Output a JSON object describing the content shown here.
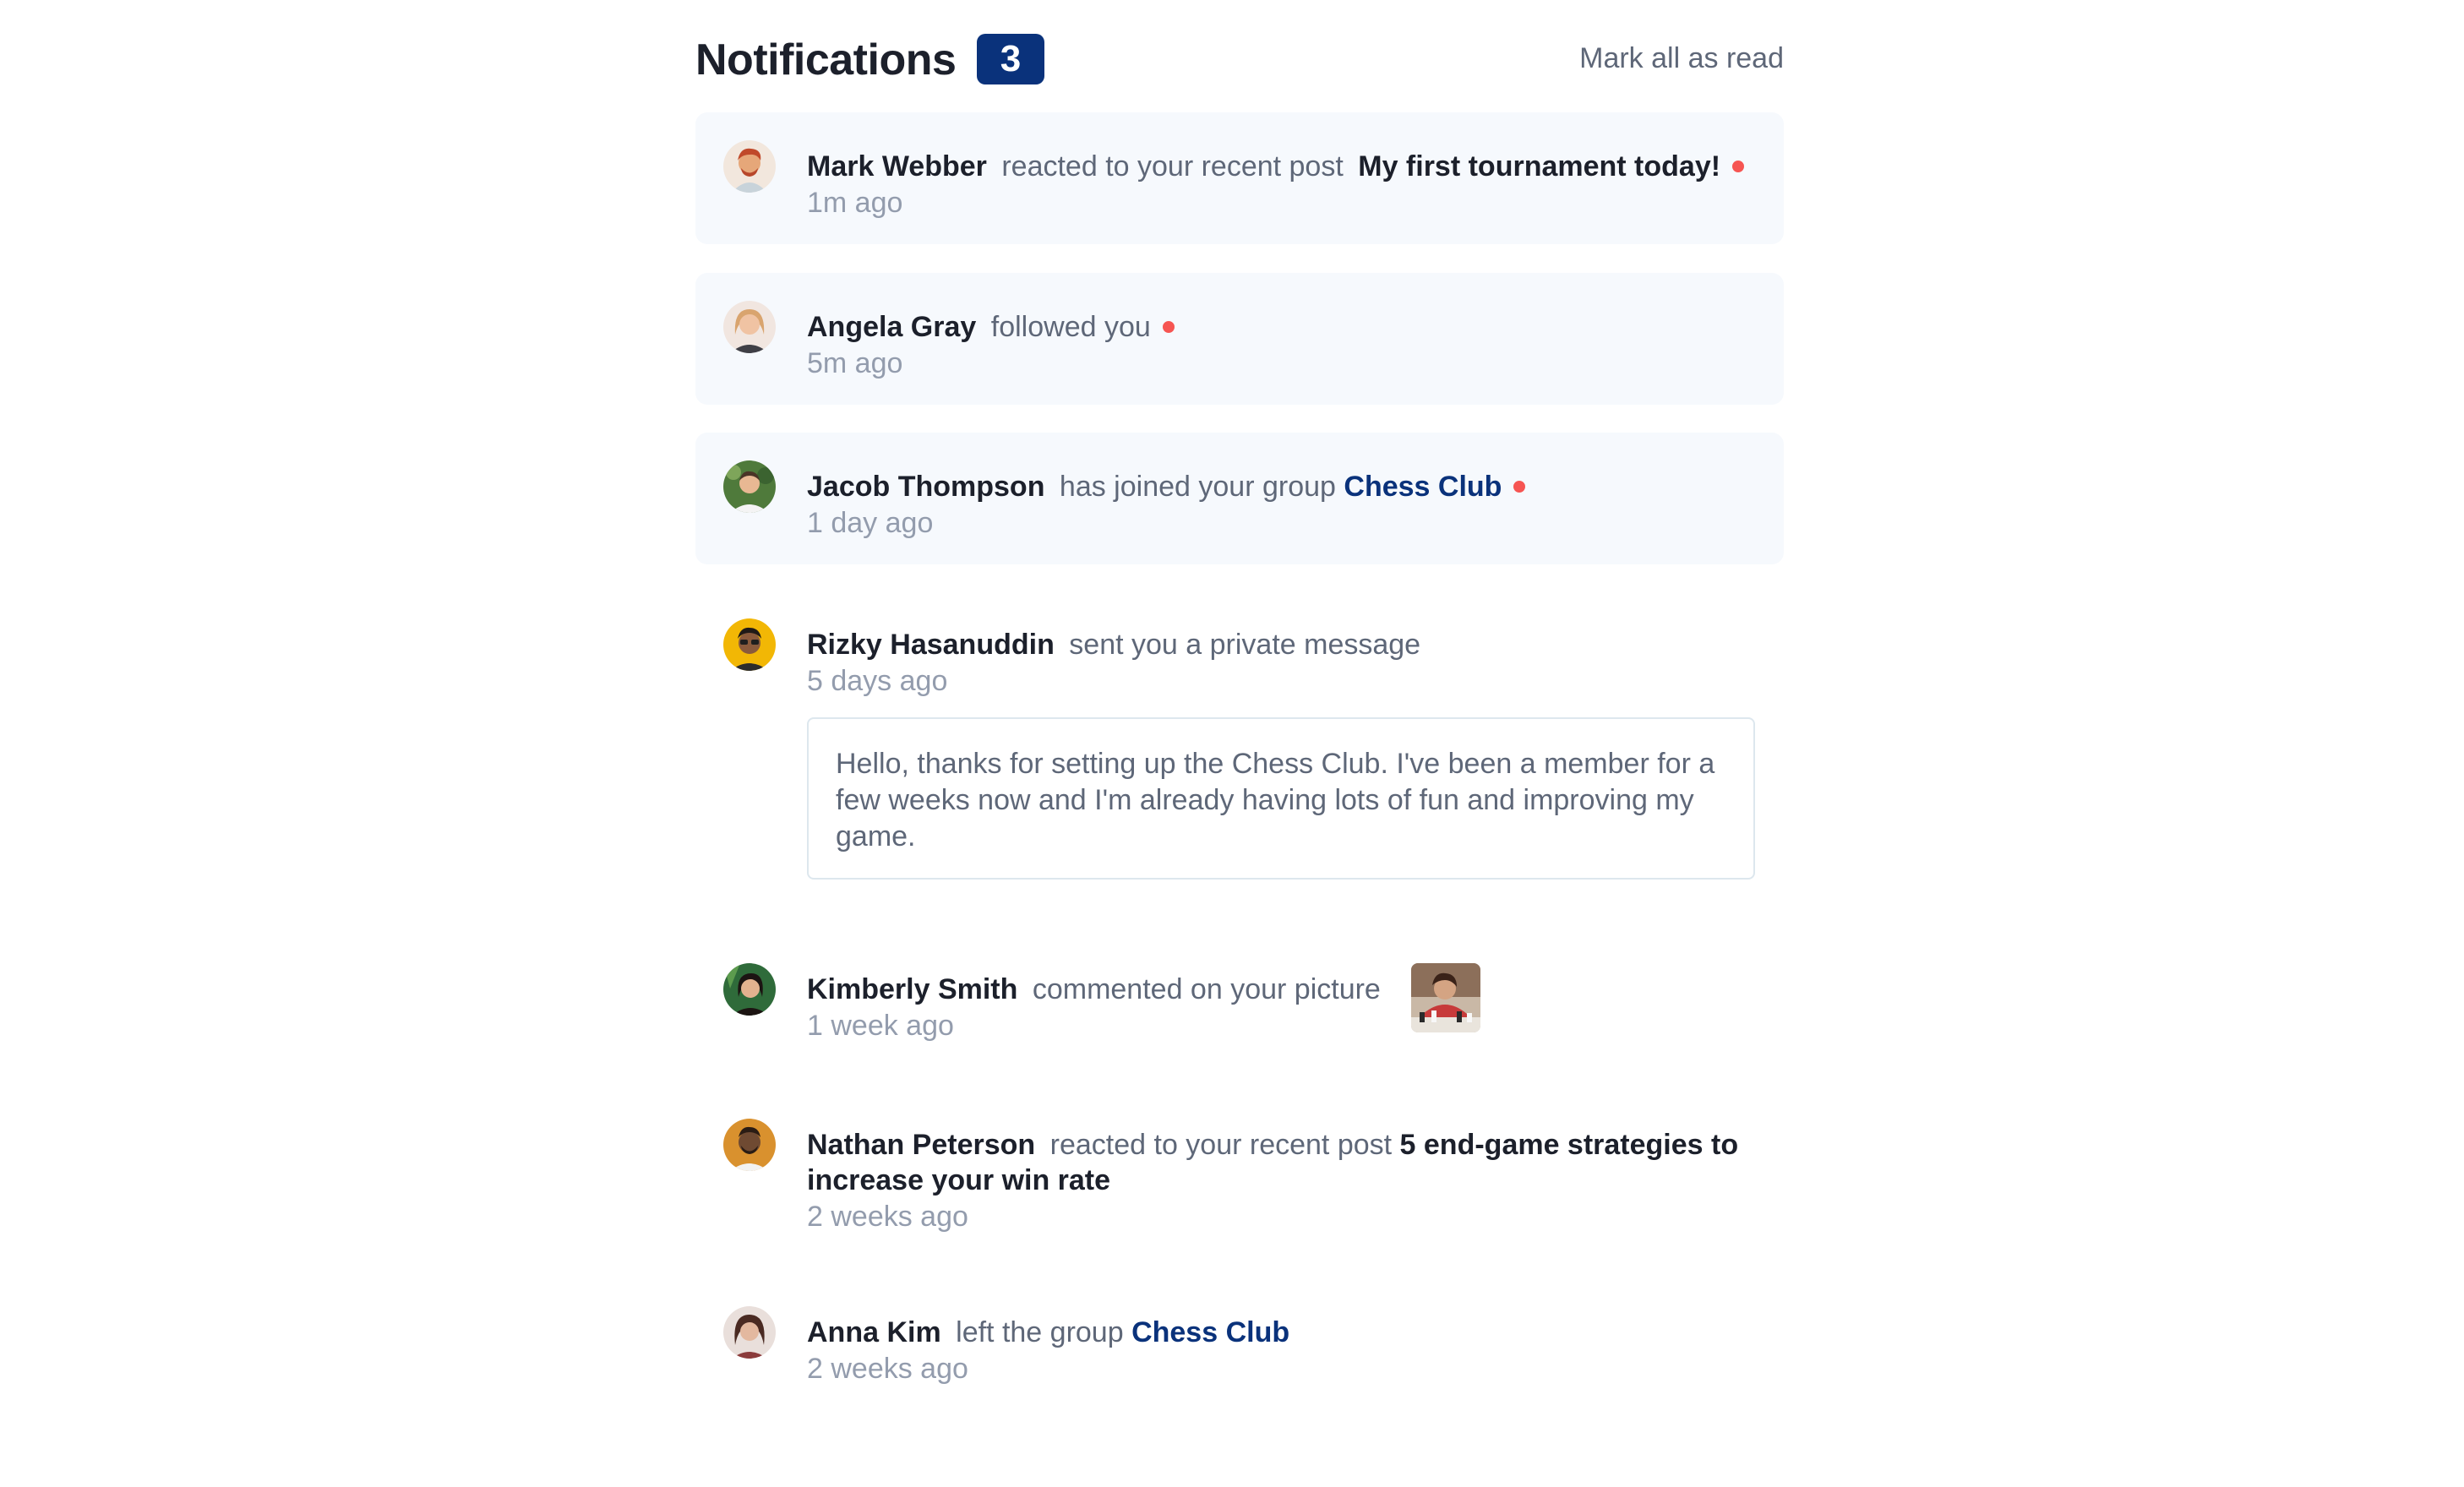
{
  "header": {
    "title": "Notifications",
    "unread_count": "3",
    "mark_all_label": "Mark all as read"
  },
  "colors": {
    "badge": "#0a327b",
    "unread_bg": "#f6f9fd",
    "dot": "#f65552",
    "group_link": "#0a327b"
  },
  "notifications": [
    {
      "name": "Mark Webber",
      "action": "reacted to your recent post",
      "post": "My first tournament today!",
      "time": "1m ago",
      "unread": true,
      "avatar": "avatar-mark-webber"
    },
    {
      "name": "Angela Gray",
      "action": "followed you",
      "time": "5m ago",
      "unread": true,
      "avatar": "avatar-angela-gray"
    },
    {
      "name": "Jacob Thompson",
      "action": "has joined your group",
      "group": "Chess Club",
      "time": "1 day ago",
      "unread": true,
      "avatar": "avatar-jacob-thompson"
    },
    {
      "name": "Rizky Hasanuddin",
      "action": "sent you a private message",
      "time": "5 days ago",
      "message": "Hello, thanks for setting up the Chess Club. I've been a member for a few weeks now and I'm already having lots of fun and improving my game.",
      "unread": false,
      "avatar": "avatar-rizky-hasanuddin"
    },
    {
      "name": "Kimberly Smith",
      "action": "commented on your picture",
      "time": "1 week ago",
      "picture": "chess-picture-thumbnail",
      "unread": false,
      "avatar": "avatar-kimberly-smith"
    },
    {
      "name": "Nathan Peterson",
      "action": "reacted to your recent post",
      "post": "5 end-game strategies to increase your win rate",
      "time": "2 weeks ago",
      "unread": false,
      "avatar": "avatar-nathan-peterson"
    },
    {
      "name": "Anna Kim",
      "action": "left the group",
      "group": "Chess Club",
      "time": "2 weeks ago",
      "unread": false,
      "avatar": "avatar-anna-kim"
    }
  ]
}
